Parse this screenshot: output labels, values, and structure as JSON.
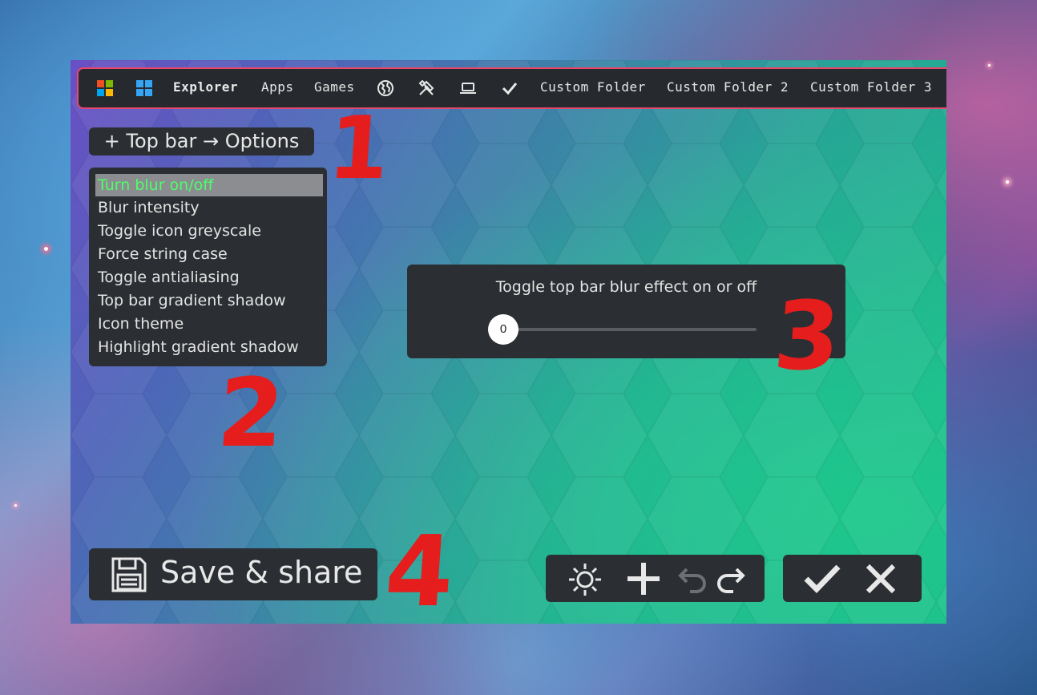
{
  "topbar": {
    "items": [
      {
        "label": "Explorer"
      },
      {
        "label": "Apps"
      },
      {
        "label": "Games"
      },
      {
        "label": "Custom Folder"
      },
      {
        "label": "Custom Folder 2"
      },
      {
        "label": "Custom Folder 3"
      }
    ],
    "icons": [
      "windows-logo-colored-icon",
      "windows-logo-blue-icon",
      "globe-icon",
      "tools-icon",
      "laptop-icon",
      "checkmark-icon"
    ],
    "border_color": "#e5486a"
  },
  "options_breadcrumb": {
    "label": "+ Top bar → Options"
  },
  "menu": {
    "items": [
      {
        "label": "Turn blur on/off"
      },
      {
        "label": "Blur intensity"
      },
      {
        "label": "Toggle icon greyscale"
      },
      {
        "label": "Force string case"
      },
      {
        "label": "Toggle antialiasing"
      },
      {
        "label": "Top bar gradient shadow"
      },
      {
        "label": "Icon theme"
      },
      {
        "label": "Highlight gradient shadow"
      }
    ],
    "selected_color": "#4cff6a"
  },
  "setting": {
    "description": "Toggle top bar blur effect on or off",
    "slider_value": "0"
  },
  "save": {
    "label": "Save & share"
  },
  "toolbar": {
    "icons": [
      "gear-icon",
      "plus-icon",
      "undo-icon",
      "redo-icon"
    ]
  },
  "confirm": {
    "icons": [
      "check-icon",
      "close-icon"
    ]
  },
  "annotations": {
    "a1": "1",
    "a2": "2",
    "a3": "3",
    "a4": "4"
  }
}
